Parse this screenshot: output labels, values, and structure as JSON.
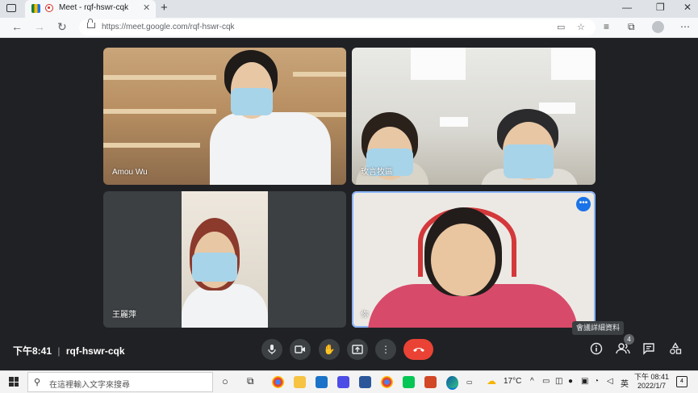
{
  "browser": {
    "tab_title": "Meet - rqf-hswr-cqk",
    "tab_close": "✕",
    "new_tab": "+",
    "url": "https://meet.google.com/rqf-hswr-cqk",
    "window_controls": [
      "—",
      "❐",
      "✕"
    ]
  },
  "meet": {
    "participants": [
      {
        "name": "Amou Wu"
      },
      {
        "name": "玫言牧區"
      },
      {
        "name": "王麗萍"
      },
      {
        "name": "你"
      }
    ],
    "more_options": "•••",
    "tooltip": "會議詳細資料",
    "time": "下午8:41",
    "separator": "|",
    "meeting_code": "rqf-hswr-cqk",
    "people_count": "4",
    "accent": "#1a73e8",
    "hangup_color": "#ea4335"
  },
  "taskbar": {
    "search_placeholder": "在這裡輸入文字來搜尋",
    "weather": "17°C",
    "ime": "英",
    "time": "下午 08:41",
    "date": "2022/1/7",
    "notifications": "4"
  }
}
